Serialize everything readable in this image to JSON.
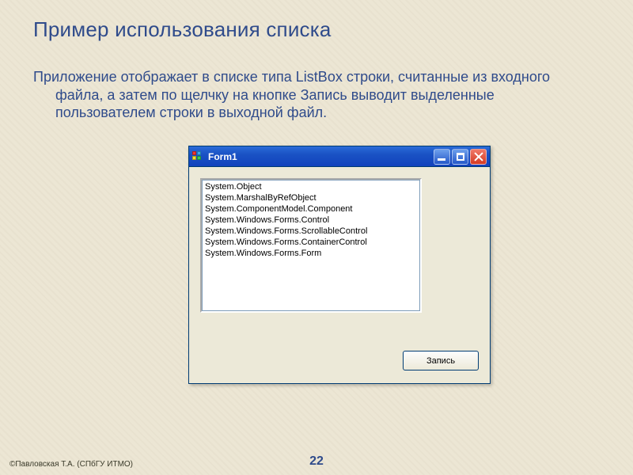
{
  "slide": {
    "title": "Пример использования списка",
    "body": "Приложение отображает в списке типа ListBox строки, считанные из входного файла, а затем по щелчку на кнопке Запись выводит выделенные пользователем строки в выходной файл.",
    "footer": "©Павловская Т.А. (СПбГУ ИТМО)",
    "page_number": "22"
  },
  "window": {
    "title": "Form1",
    "listbox_items": [
      "System.Object",
      "System.MarshalByRefObject",
      "System.ComponentModel.Component",
      "System.Windows.Forms.Control",
      "System.Windows.Forms.ScrollableControl",
      "System.Windows.Forms.ContainerControl",
      "System.Windows.Forms.Form"
    ],
    "button_label": "Запись"
  }
}
